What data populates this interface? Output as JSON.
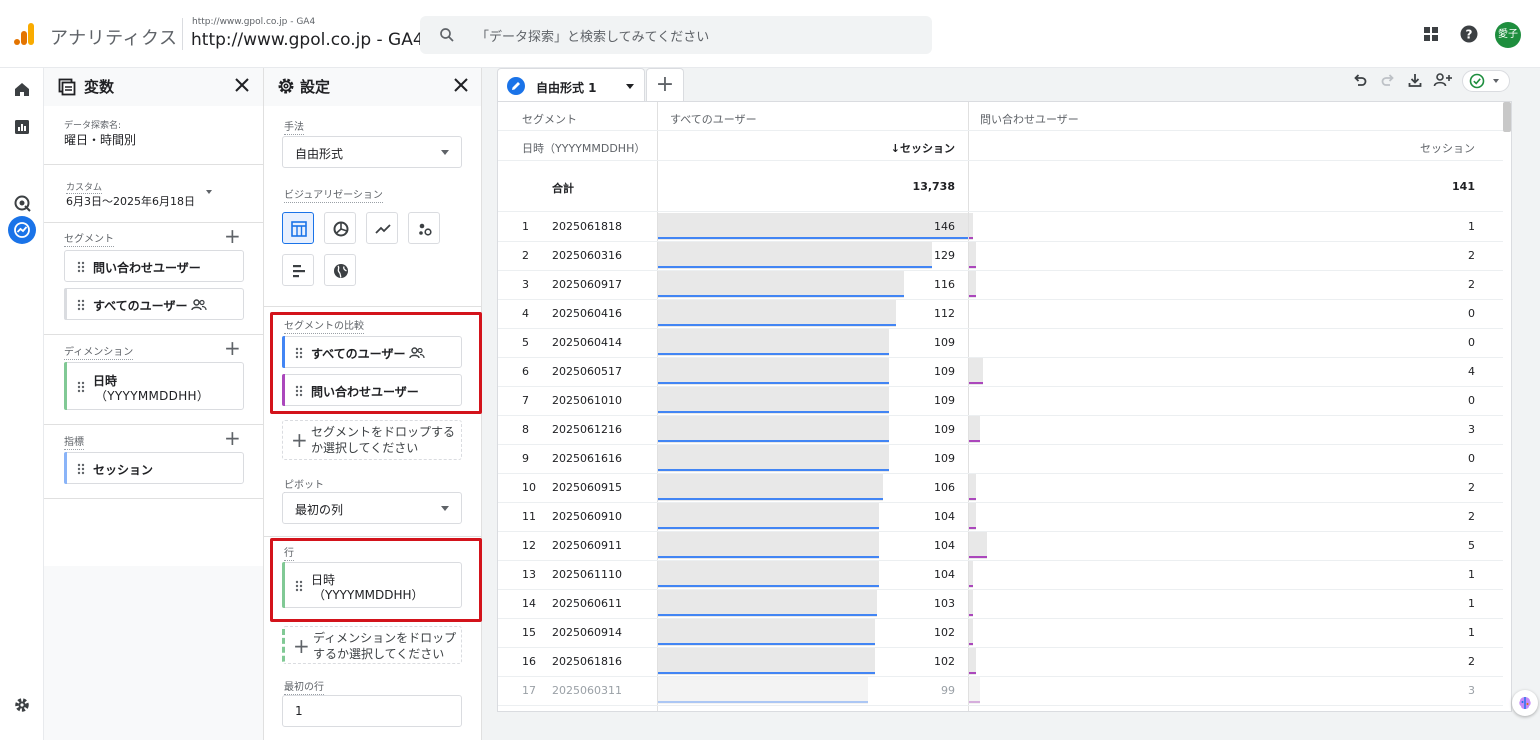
{
  "header": {
    "app_title": "アナリティクス",
    "property_small": "http://www.gpol.co.jp - GA4",
    "property_big": "http://www.gpol.co.jp - GA4",
    "search_placeholder": "「データ探索」と検索してみてください",
    "avatar_text": "愛子"
  },
  "variables": {
    "title": "変数",
    "exploration_name_label": "データ探索名:",
    "exploration_name": "曜日・時間別",
    "date_custom_label": "カスタム",
    "date_range": "6月3日～2025年6月18日",
    "segments_label": "セグメント",
    "segments": [
      "問い合わせユーザー",
      "すべてのユーザー"
    ],
    "dimensions_label": "ディメンション",
    "dimension_line1": "日時",
    "dimension_line2": "（YYYYMMDDHH）",
    "metrics_label": "指標",
    "metric": "セッション"
  },
  "settings": {
    "title": "設定",
    "technique_label": "手法",
    "technique_value": "自由形式",
    "viz_label": "ビジュアリゼーション",
    "segment_compare_label": "セグメントの比較",
    "segment_compare": [
      "すべてのユーザー",
      "問い合わせユーザー"
    ],
    "segment_drop_line1": "セグメントをドロップする",
    "segment_drop_line2": "か選択してください",
    "pivot_label": "ピボット",
    "pivot_value": "最初の列",
    "rows_label": "行",
    "row_line1": "日時",
    "row_line2": "（YYYYMMDDHH）",
    "dim_drop_line1": "ディメンションをドロップ",
    "dim_drop_line2": "するか選択してください",
    "first_row_label": "最初の行",
    "first_row_value": "1"
  },
  "tab": {
    "label": "自由形式 1",
    "add": "+"
  },
  "colors": {
    "all_users": "#4285f4",
    "inquiry_users": "#ab47bc",
    "dimension": "#81c995",
    "metric": "#8ab4f8",
    "highlight": "#d3131b"
  },
  "table": {
    "segment_header": "セグメント",
    "dimension_header": "日時（YYYYMMDDHH）",
    "col1_segment": "すべてのユーザー",
    "col2_segment": "問い合わせユーザー",
    "col1_metric": "↓セッション",
    "col2_metric": "セッション",
    "total_label": "合計",
    "total_all": "13,738",
    "total_inquiry": "141",
    "max_all": 146,
    "max_inquiry": 5,
    "rows": [
      {
        "idx": "1",
        "date": "2025061818",
        "all": 146,
        "inq": 1
      },
      {
        "idx": "2",
        "date": "2025060316",
        "all": 129,
        "inq": 2
      },
      {
        "idx": "3",
        "date": "2025060917",
        "all": 116,
        "inq": 2
      },
      {
        "idx": "4",
        "date": "2025060416",
        "all": 112,
        "inq": 0
      },
      {
        "idx": "5",
        "date": "2025060414",
        "all": 109,
        "inq": 0
      },
      {
        "idx": "6",
        "date": "2025060517",
        "all": 109,
        "inq": 4
      },
      {
        "idx": "7",
        "date": "2025061010",
        "all": 109,
        "inq": 0
      },
      {
        "idx": "8",
        "date": "2025061216",
        "all": 109,
        "inq": 3
      },
      {
        "idx": "9",
        "date": "2025061616",
        "all": 109,
        "inq": 0
      },
      {
        "idx": "10",
        "date": "2025060915",
        "all": 106,
        "inq": 2
      },
      {
        "idx": "11",
        "date": "2025060910",
        "all": 104,
        "inq": 2
      },
      {
        "idx": "12",
        "date": "2025060911",
        "all": 104,
        "inq": 5
      },
      {
        "idx": "13",
        "date": "2025061110",
        "all": 104,
        "inq": 1
      },
      {
        "idx": "14",
        "date": "2025060611",
        "all": 103,
        "inq": 1
      },
      {
        "idx": "15",
        "date": "2025060914",
        "all": 102,
        "inq": 1
      },
      {
        "idx": "16",
        "date": "2025061816",
        "all": 102,
        "inq": 2
      },
      {
        "idx": "17",
        "date": "2025060311",
        "all": 99,
        "inq": 3
      }
    ]
  }
}
